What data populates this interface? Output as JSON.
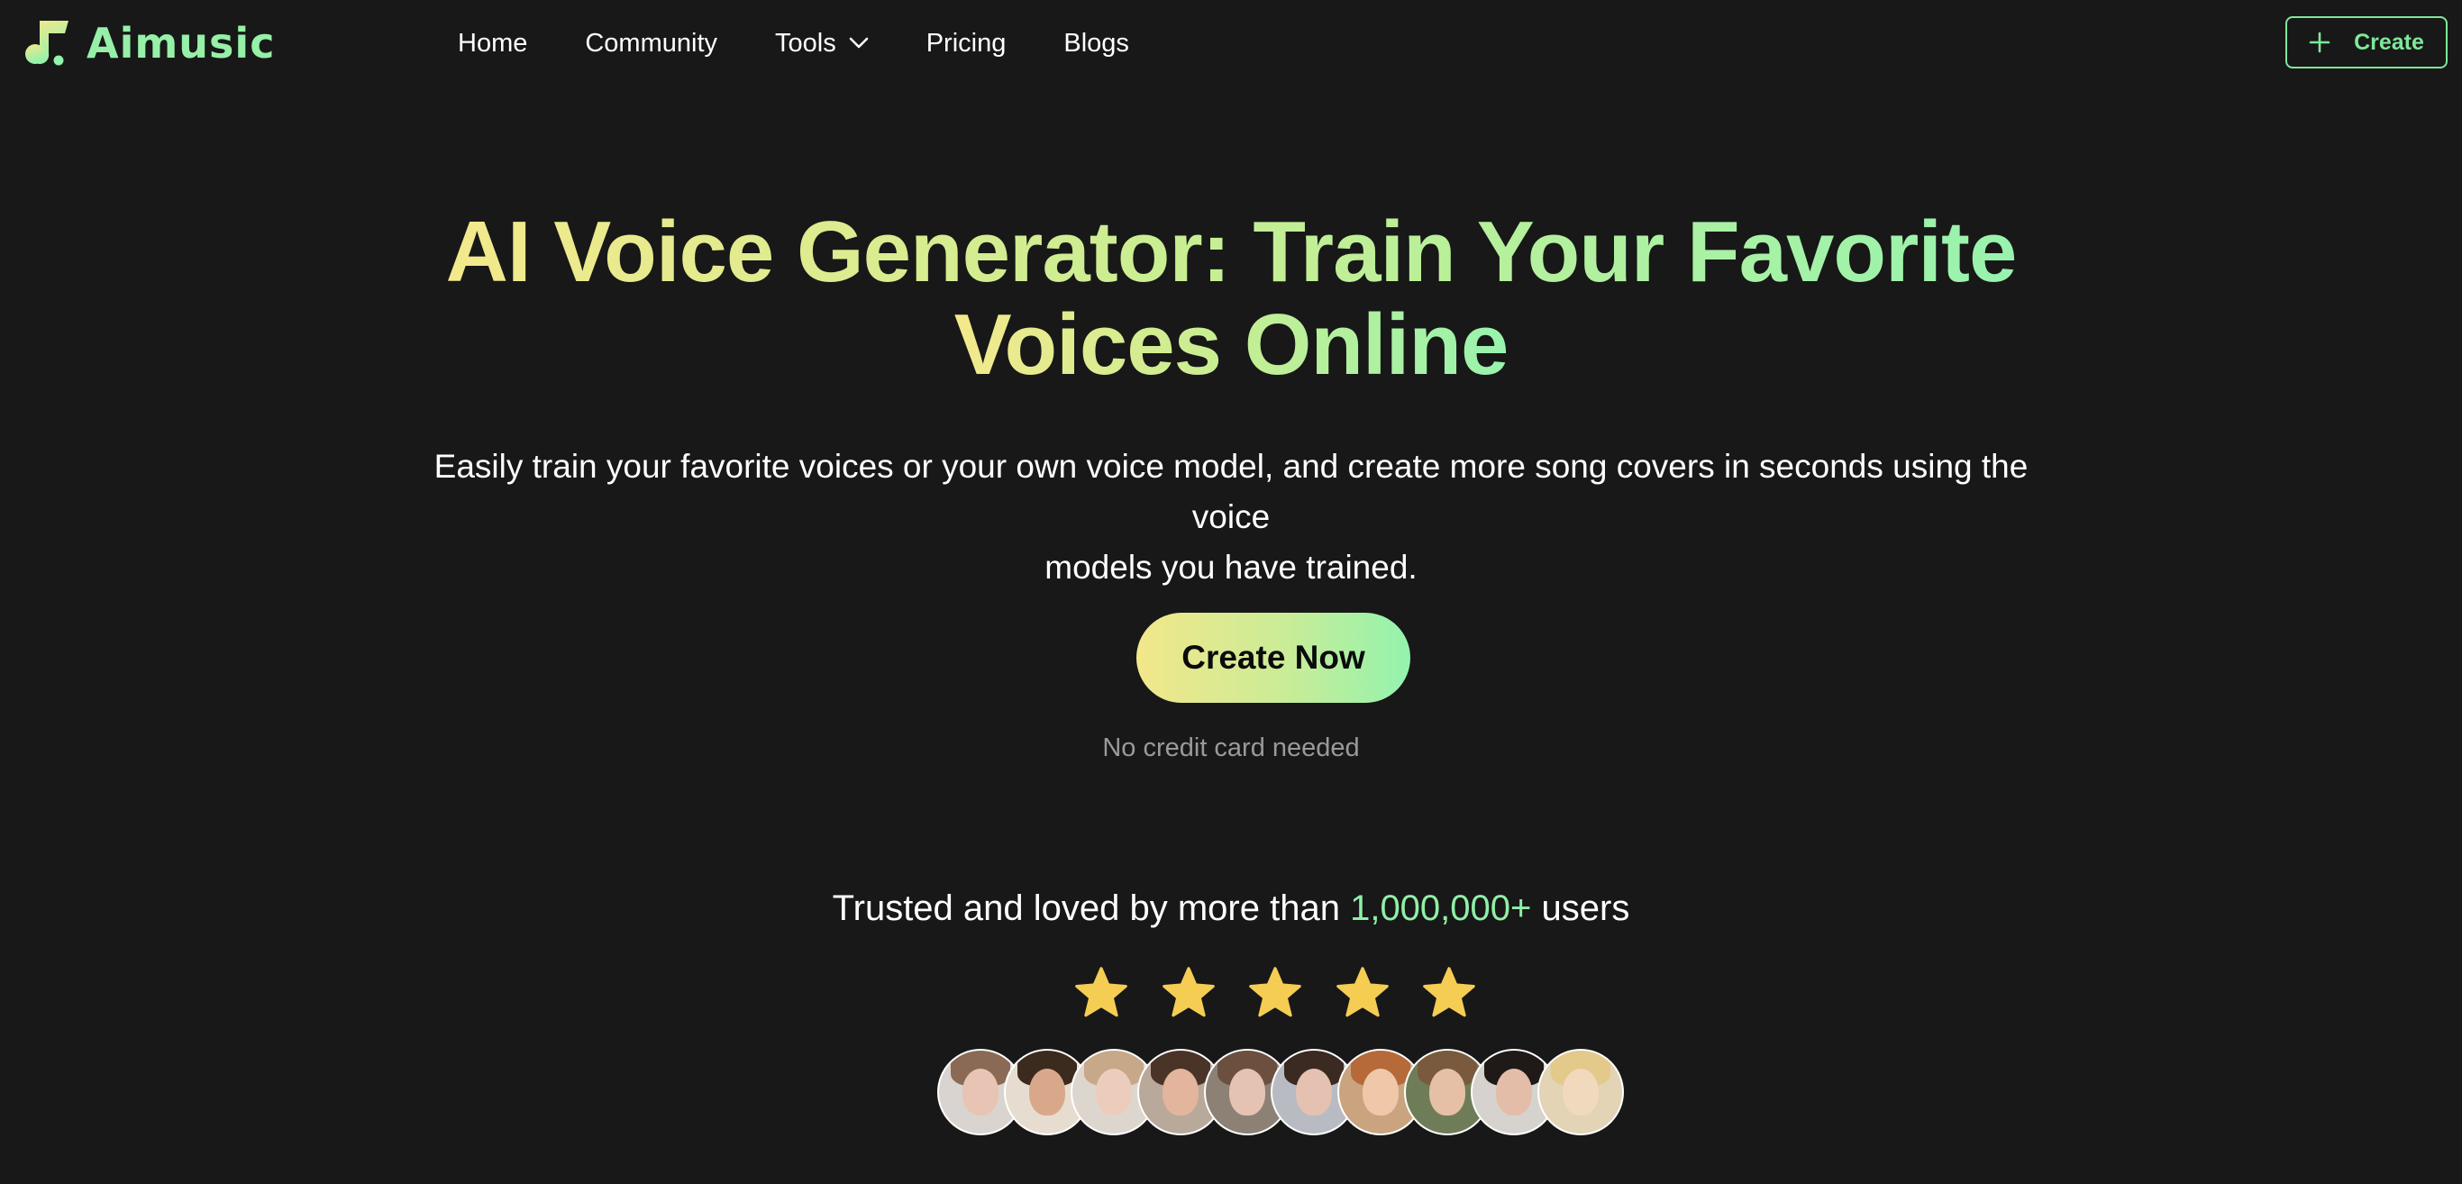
{
  "header": {
    "logo_text": "Aimusic",
    "logo_icon": "music-note-icon",
    "nav": [
      {
        "label": "Home"
      },
      {
        "label": "Community"
      },
      {
        "label": "Tools",
        "has_dropdown": true
      },
      {
        "label": "Pricing"
      },
      {
        "label": "Blogs"
      }
    ],
    "create_button": {
      "label": "Create",
      "icon": "plus-icon"
    }
  },
  "hero": {
    "title_line1": "AI Voice Generator: Train Your Favorite",
    "title_line2": "Voices Online",
    "subtitle_line1": "Easily train your favorite voices or your own voice model, and create more song covers in seconds using the voice",
    "subtitle_line2": "models you have trained.",
    "cta_label": "Create Now",
    "cta_note": "No credit card needed"
  },
  "social_proof": {
    "trusted_prefix": "Trusted and loved by more than",
    "trusted_count": "1,000,000+",
    "trusted_suffix": "users",
    "rating_stars": 5,
    "rating_max": 5,
    "avatars_count": 10
  },
  "colors": {
    "background": "#181818",
    "accent_green": "#8ff0a6",
    "accent_yellow": "#f3e98c",
    "star": "#f5cd52",
    "muted_text": "#9a9a9a"
  }
}
